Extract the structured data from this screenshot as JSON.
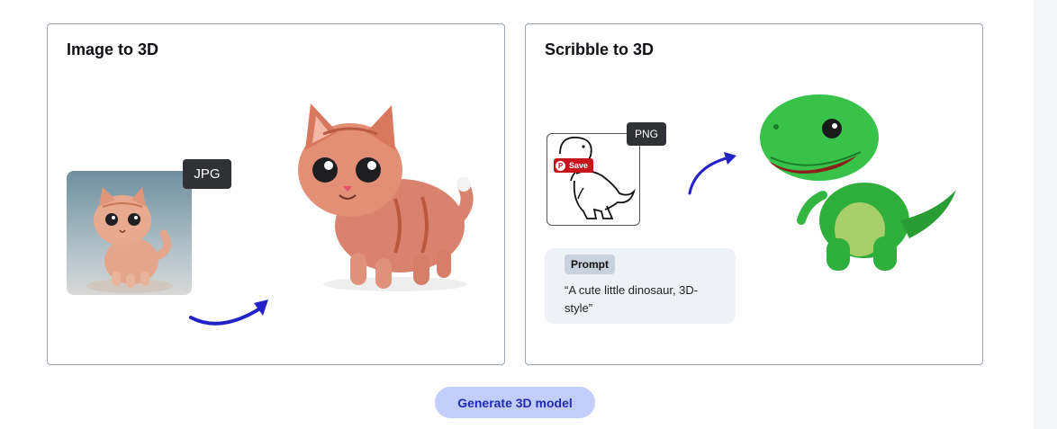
{
  "cards": {
    "image_to_3d": {
      "title": "Image to 3D",
      "format_tag": "JPG"
    },
    "scribble_to_3d": {
      "title": "Scribble to 3D",
      "format_tag": "PNG",
      "save_label": "Save",
      "prompt_label": "Prompt",
      "prompt_text": "“A cute little dinosaur, 3D-style”"
    }
  },
  "generate_button": "Generate 3D model",
  "colors": {
    "arrow": "#2222c8",
    "button_bg": "#c2cdfb",
    "button_text": "#1f2bb4",
    "save_red": "#c8141c"
  },
  "icons": {
    "arrow": "curved-arrow-icon",
    "pin": "pinterest-icon"
  }
}
